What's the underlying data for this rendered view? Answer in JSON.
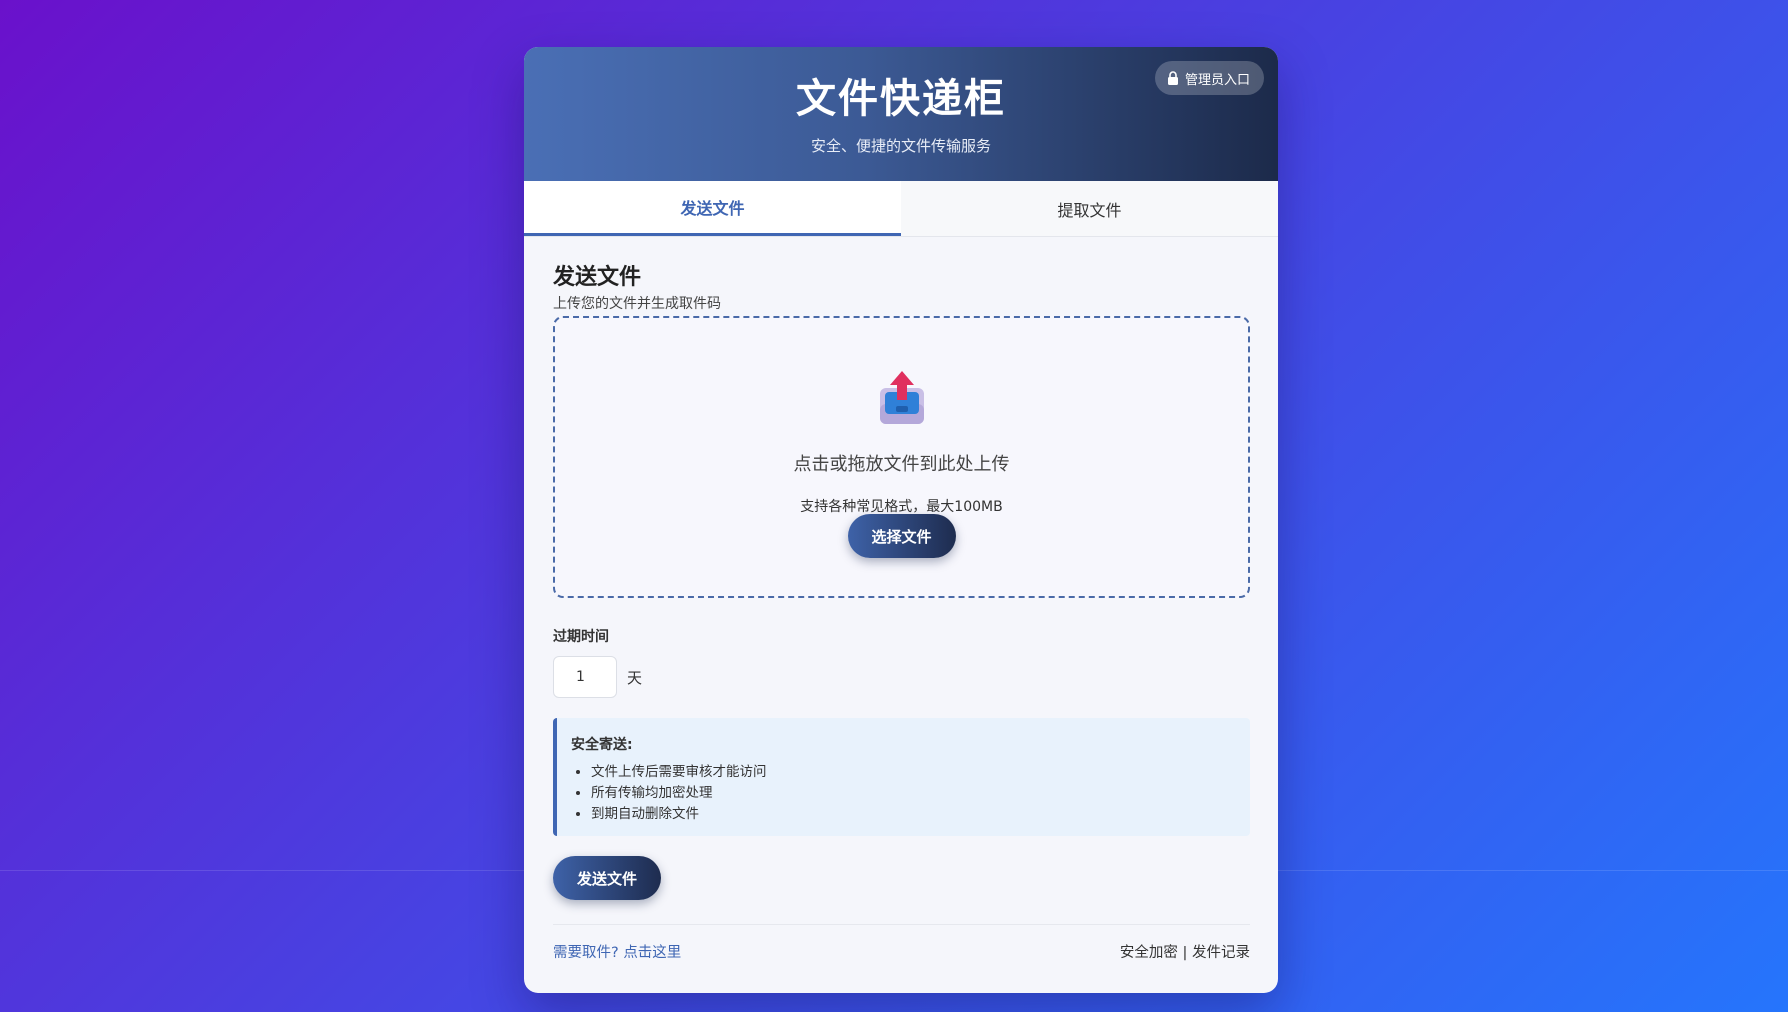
{
  "header": {
    "title": "文件快递柜",
    "subtitle": "安全、便捷的文件传输服务",
    "admin_label": "管理员入口"
  },
  "tabs": [
    {
      "label": "发送文件",
      "active": true
    },
    {
      "label": "提取文件",
      "active": false
    }
  ],
  "send": {
    "title": "发送文件",
    "subtitle": "上传您的文件并生成取件码",
    "dropzone": {
      "main_text": "点击或拖放文件到此处上传",
      "hint": "支持各种常见格式，最大100MB",
      "button_label": "选择文件"
    },
    "expire": {
      "label": "过期时间",
      "value": "1",
      "unit": "天"
    },
    "info": {
      "title": "安全寄送:",
      "items": [
        "文件上传后需要审核才能访问",
        "所有传输均加密处理",
        "到期自动删除文件"
      ]
    },
    "submit_label": "发送文件"
  },
  "footer": {
    "left_prefix": "需要取件?",
    "left_link": "点击这里",
    "right_item1": "安全加密",
    "separator": "|",
    "right_item2": "发件记录"
  },
  "colors": {
    "accent": "#3f66b3",
    "header_dark": "#1c2a4a",
    "info_bg": "#e8f2fc"
  }
}
